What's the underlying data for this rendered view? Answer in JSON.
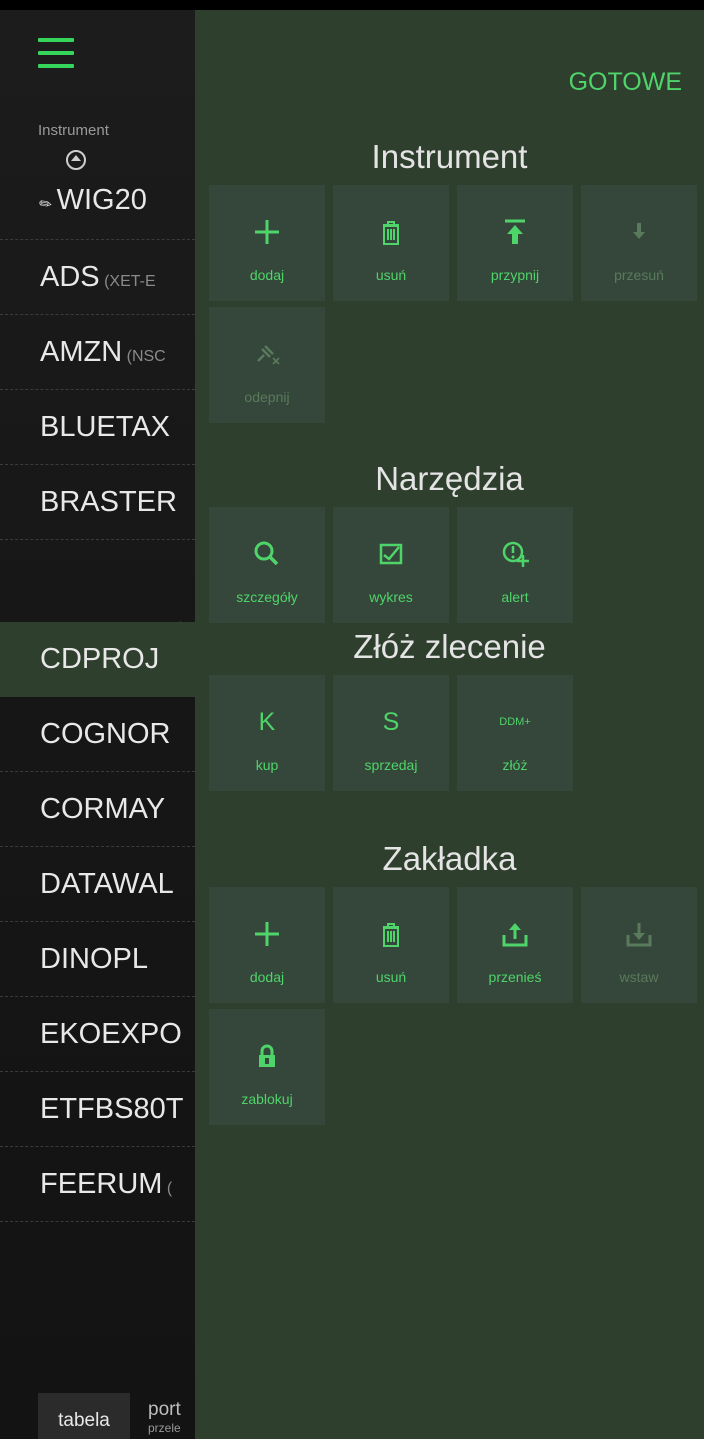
{
  "colors": {
    "accent": "#4fd46a",
    "panel": "#2f3f2e",
    "tile": "#35463a",
    "disabled": "#5a7a5c"
  },
  "list": {
    "column_header": "Instrument",
    "rows": [
      {
        "symbol": "WIG20",
        "sub": ""
      },
      {
        "symbol": "ADS",
        "sub": " (XET-E"
      },
      {
        "symbol": "AMZN",
        "sub": " (NSC"
      },
      {
        "symbol": "BLUETAX",
        "sub": ""
      },
      {
        "symbol": "BRASTER",
        "sub": ""
      },
      {
        "symbol": "CDPROJ",
        "sub": ""
      },
      {
        "symbol": "COGNOR",
        "sub": ""
      },
      {
        "symbol": "CORMAY",
        "sub": ""
      },
      {
        "symbol": "DATAWAL",
        "sub": ""
      },
      {
        "symbol": "DINOPL",
        "sub": ""
      },
      {
        "symbol": "EKOEXPO",
        "sub": ""
      },
      {
        "symbol": "ETFBS80T",
        "sub": ""
      },
      {
        "symbol": "FEERUM",
        "sub": " ("
      }
    ],
    "tabs": {
      "active": "tabela",
      "second": "port",
      "second_sub": "przele"
    }
  },
  "panel": {
    "done_label": "GOTOWE",
    "instrument": {
      "title": "Instrument",
      "buttons": [
        {
          "label": "dodaj",
          "icon": "plus-icon",
          "enabled": true
        },
        {
          "label": "usuń",
          "icon": "trash-icon",
          "enabled": true
        },
        {
          "label": "przypnij",
          "icon": "pin-top-icon",
          "enabled": true
        },
        {
          "label": "przesuń",
          "icon": "arrow-down-icon",
          "enabled": false
        },
        {
          "label": "odepnij",
          "icon": "unpin-icon",
          "enabled": false
        }
      ]
    },
    "tools": {
      "title": "Narzędzia",
      "buttons": [
        {
          "label": "szczegóły",
          "icon": "magnifier-icon"
        },
        {
          "label": "wykres",
          "icon": "chart-check-icon"
        },
        {
          "label": "alert",
          "icon": "alert-add-icon"
        }
      ]
    },
    "order": {
      "title": "Złóż zlecenie",
      "buttons": [
        {
          "label": "kup",
          "glyph": "K"
        },
        {
          "label": "sprzedaj",
          "glyph": "S"
        },
        {
          "label": "złóż",
          "glyph": "DDM+"
        }
      ]
    },
    "tab": {
      "title": "Zakładka",
      "buttons": [
        {
          "label": "dodaj",
          "icon": "plus-icon",
          "enabled": true
        },
        {
          "label": "usuń",
          "icon": "trash-icon",
          "enabled": true
        },
        {
          "label": "przenieś",
          "icon": "upload-icon",
          "enabled": true
        },
        {
          "label": "wstaw",
          "icon": "download-icon",
          "enabled": false
        },
        {
          "label": "zablokuj",
          "icon": "lock-icon",
          "enabled": true
        }
      ]
    }
  }
}
